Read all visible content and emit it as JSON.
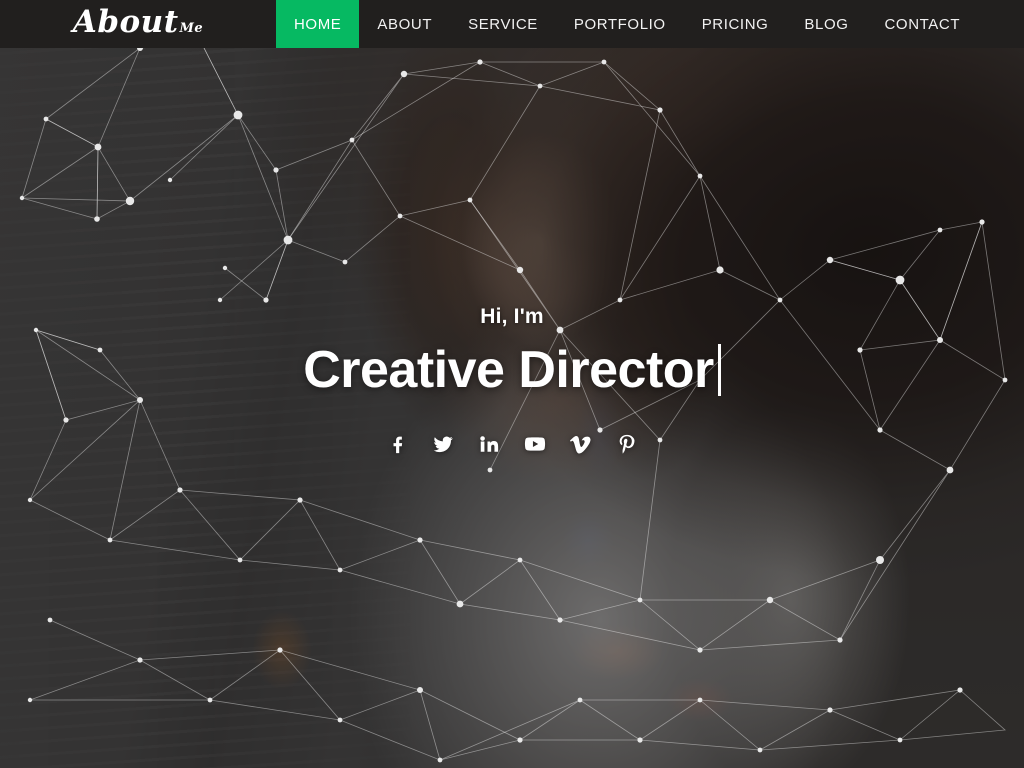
{
  "header": {
    "brand": {
      "main": "About",
      "sub": "Me"
    },
    "nav": [
      {
        "label": "HOME",
        "name": "nav-item-home",
        "active": true
      },
      {
        "label": "ABOUT",
        "name": "nav-item-about",
        "active": false
      },
      {
        "label": "SERVICE",
        "name": "nav-item-service",
        "active": false
      },
      {
        "label": "PORTFOLIO",
        "name": "nav-item-portfolio",
        "active": false
      },
      {
        "label": "PRICING",
        "name": "nav-item-pricing",
        "active": false
      },
      {
        "label": "BLOG",
        "name": "nav-item-blog",
        "active": false
      },
      {
        "label": "CONTACT",
        "name": "nav-item-contact",
        "active": false
      }
    ]
  },
  "hero": {
    "greeting": "Hi, I'm",
    "headline": "Creative Director",
    "typing_cursor": "|",
    "social": [
      {
        "label": "Facebook",
        "icon": "facebook-icon"
      },
      {
        "label": "Twitter",
        "icon": "twitter-icon"
      },
      {
        "label": "LinkedIn",
        "icon": "linkedin-icon"
      },
      {
        "label": "YouTube",
        "icon": "youtube-icon"
      },
      {
        "label": "Vimeo",
        "icon": "vimeo-icon"
      },
      {
        "label": "Pinterest",
        "icon": "pinterest-icon"
      }
    ]
  },
  "colors": {
    "accent_green": "#06b962",
    "header_bg": "#211f1e",
    "text_light": "#ffffff",
    "overlay": "rgba(28,26,26,0.42)"
  }
}
